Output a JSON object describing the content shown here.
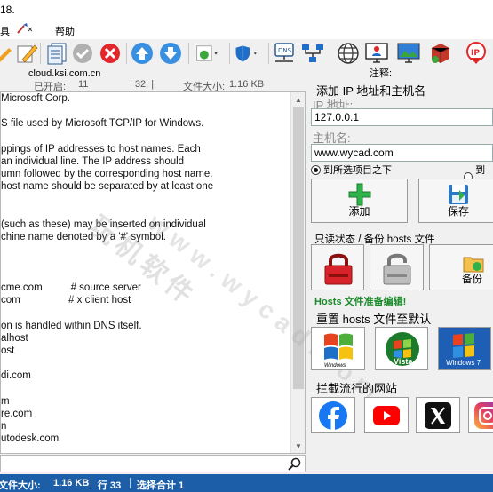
{
  "window": {
    "title": "18."
  },
  "menu": {
    "items": [
      "具",
      "帮助"
    ]
  },
  "toolbar": {
    "caption_site": "cloud.ksi.com.cn",
    "caption_note": "注释:"
  },
  "info": {
    "opened_label": "已开启:",
    "opened_value": "11",
    "col_value": "| 32. |",
    "size_label": "文件大小:",
    "size_value": "1.16 KB"
  },
  "editor": {
    "lines": [
      "Microsoft Corp.",
      "",
      "S file used by Microsoft TCP/IP for Windows.",
      "",
      "ppings of IP addresses to host names. Each",
      "an individual line. The IP address should",
      "umn followed by the corresponding host name.",
      "host name should be separated by at least one",
      "",
      "",
      "(such as these) may be inserted on individual",
      "chine name denoted by a '#' symbol.",
      "",
      "",
      "",
      "cme.com          # source server",
      "com                 # x client host",
      "",
      "on is handled within DNS itself.",
      "alhost",
      "ost",
      "",
      "di.com",
      "",
      "m",
      "re.com",
      "n",
      "utodesk.com",
      "  .  ."
    ]
  },
  "status": {
    "size_label": "文件大小:",
    "size_value": "1.16 KB",
    "line_label": "行 33",
    "selection_label": "选择合计 1"
  },
  "panel": {
    "add_title": "添加 IP 地址和主机名",
    "ip_label": "IP 地址:",
    "ip_value": "127.0.0.1",
    "host_label": "主机名:",
    "host_value": "www.wycad.com",
    "radio_before": "到所选项目之下",
    "radio_end": "到列",
    "add_button": "添加",
    "save_button": "保存",
    "readonly_title": "只读状态 / 备份 hosts 文件",
    "backup_button": "备份",
    "ready_text": "Hosts 文件准备编辑!",
    "reset_title": "重置 hosts 文件至默认",
    "os_windows_xp": "Windows",
    "os_vista": "Vista",
    "os_windows7": "Windows 7",
    "block_title": "拦截流行的网站"
  },
  "watermark": {
    "line1": "玩机软件",
    "line2": "www.wycad.com"
  }
}
